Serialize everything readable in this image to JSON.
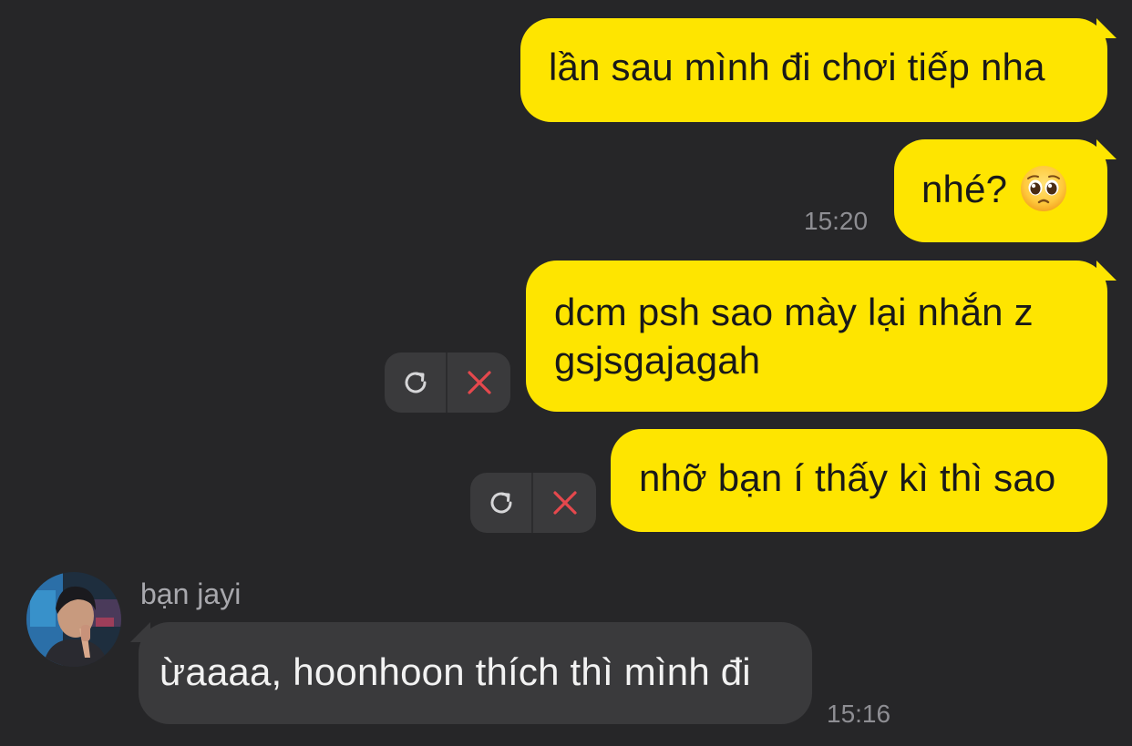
{
  "messages": {
    "out1": "lần sau mình đi chơi tiếp nha",
    "out2": "nhé?",
    "out2_emoji": "pleading-face",
    "out2_time": "15:20",
    "out3_line1": "dcm psh sao mày lại nhắn z",
    "out3_line2": "gsjsgajagah",
    "out4": "nhỡ bạn í thấy kì thì sao",
    "in1_sender": "bạn jayi",
    "in1_text": "ừaaaa, hoonhoon thích thì mình đi",
    "in1_time": "15:16"
  },
  "icons": {
    "retry": "retry-icon",
    "delete": "close-icon"
  },
  "colors": {
    "background": "#262628",
    "outgoing_bubble": "#FEE500",
    "incoming_bubble": "#3A3A3C",
    "delete_red": "#E5484D"
  }
}
